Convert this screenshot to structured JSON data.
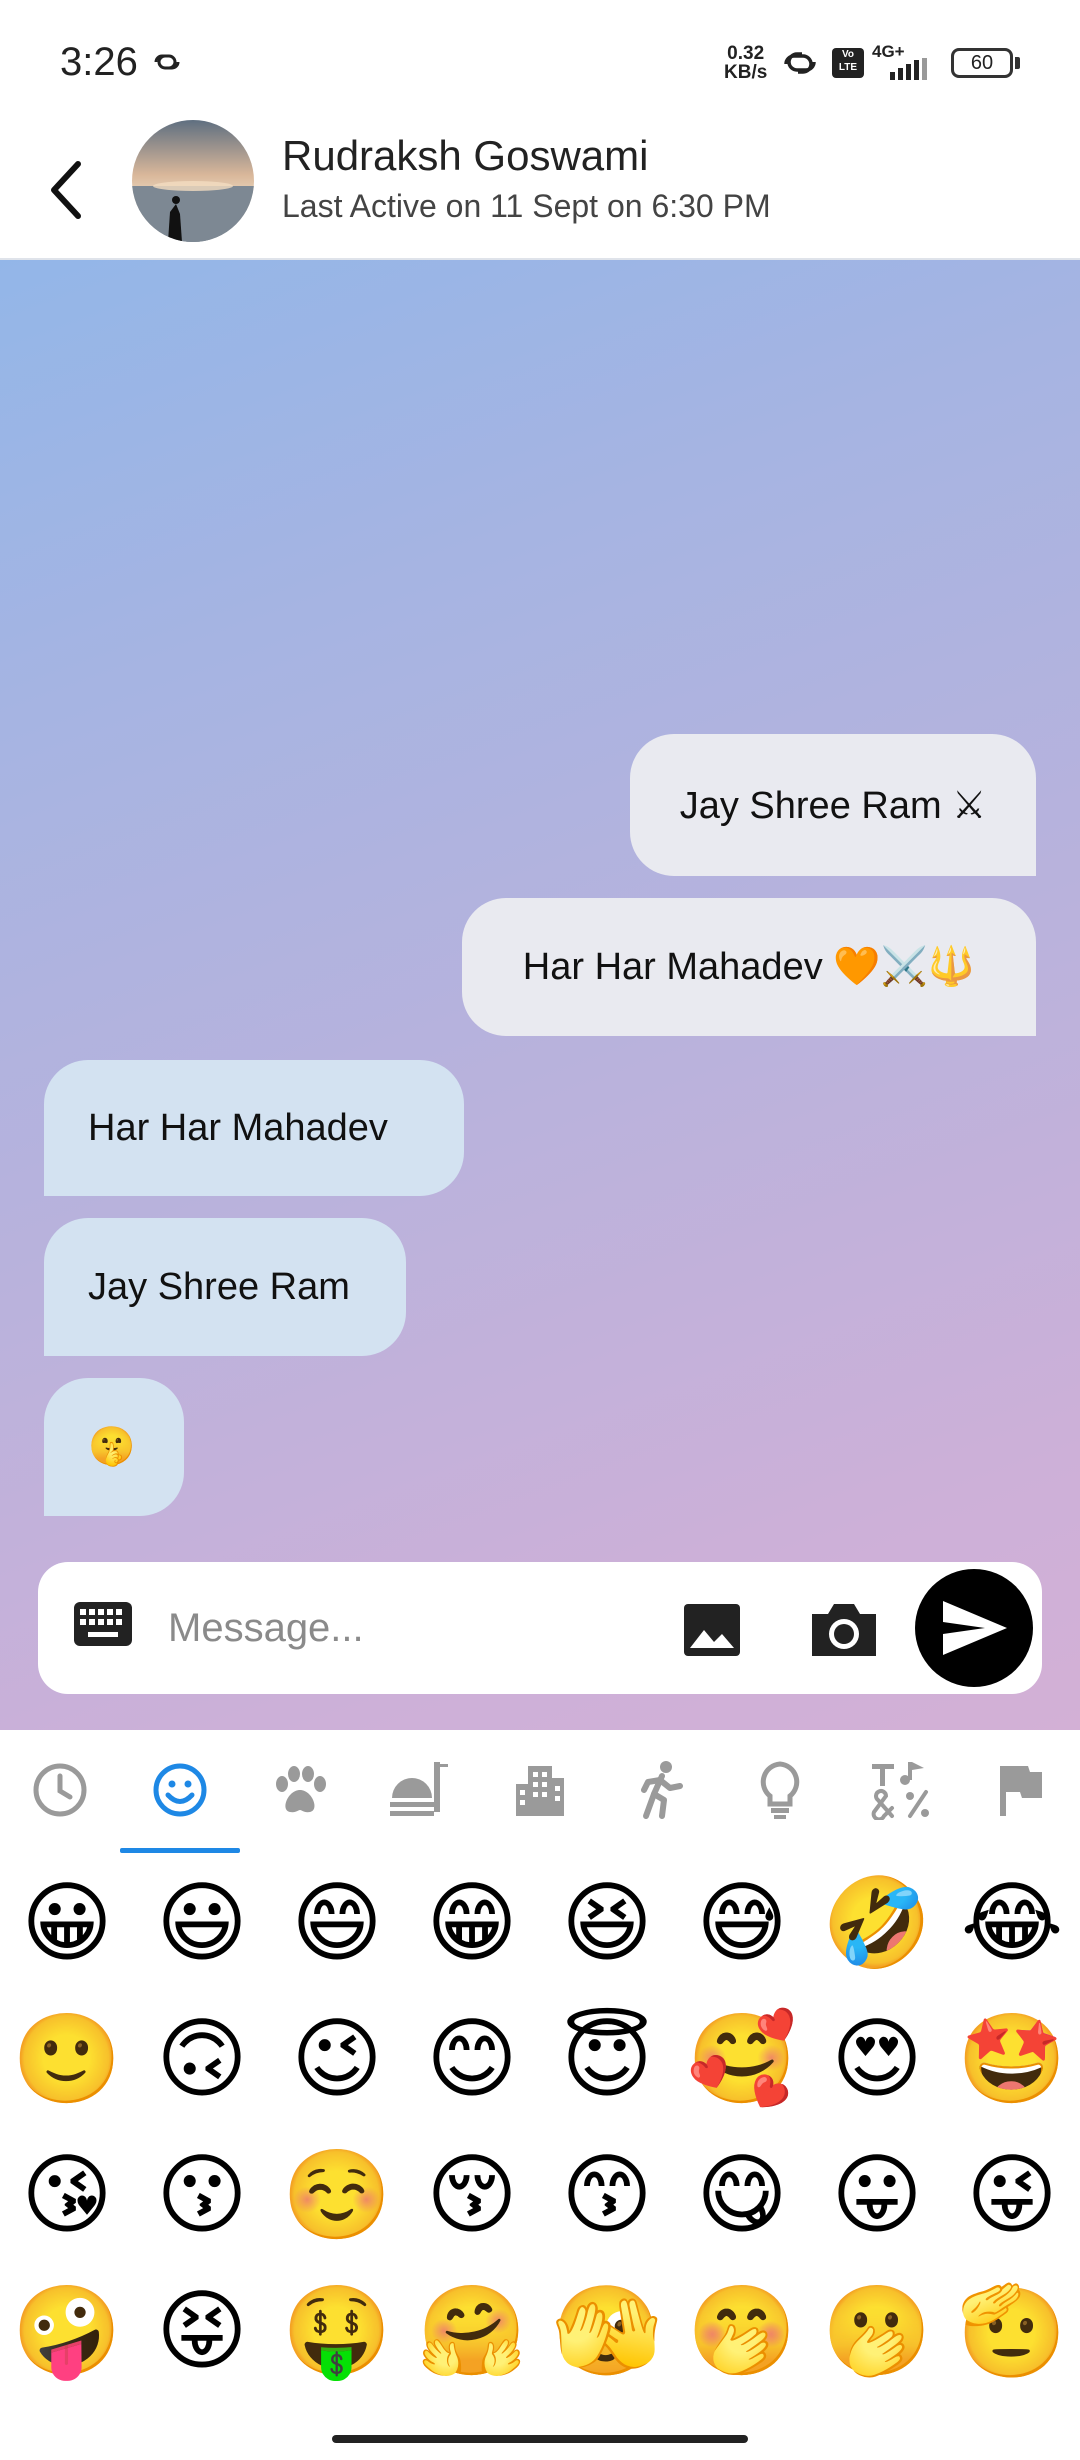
{
  "status_bar": {
    "time": "3:26",
    "net_speed_value": "0.32",
    "net_speed_unit": "KB/s",
    "volte": "Vo LTE",
    "network": "4G+",
    "battery": "60"
  },
  "header": {
    "name": "Rudraksh Goswami",
    "last_active": "Last Active on 11 Sept on 6:30 PM"
  },
  "messages": [
    {
      "direction": "out",
      "text": "Jay Shree Ram ⚔"
    },
    {
      "direction": "out",
      "text": "Har Har Mahadev 🧡⚔️🔱"
    },
    {
      "direction": "in",
      "text": "Har Har Mahadev"
    },
    {
      "direction": "in",
      "text": "Jay Shree Ram"
    },
    {
      "direction": "in",
      "text": "🤫"
    }
  ],
  "composer": {
    "placeholder": "Message..."
  },
  "emoji_panel": {
    "categories": [
      "recent-icon",
      "smileys-icon",
      "animals-icon",
      "food-icon",
      "places-icon",
      "activities-icon",
      "objects-icon",
      "symbols-icon",
      "flags-icon"
    ],
    "selected_category": "smileys",
    "rows": [
      [
        "😀",
        "😃",
        "😄",
        "😁",
        "😆",
        "😅",
        "🤣",
        "😂"
      ],
      [
        "🙂",
        "🙃",
        "😉",
        "😊",
        "😇",
        "🥰",
        "😍",
        "🤩"
      ],
      [
        "😘",
        "😗",
        "☺️",
        "😚",
        "😙",
        "😋",
        "😛",
        "😜"
      ],
      [
        "🤪",
        "😝",
        "🤑",
        "🤗",
        "🫣",
        "🤭",
        "🫢",
        "🫡"
      ]
    ]
  },
  "colors": {
    "accent": "#1e88e5",
    "outgoing_bubble": "#e9eaf0",
    "incoming_bubble": "#d3e2f1"
  }
}
